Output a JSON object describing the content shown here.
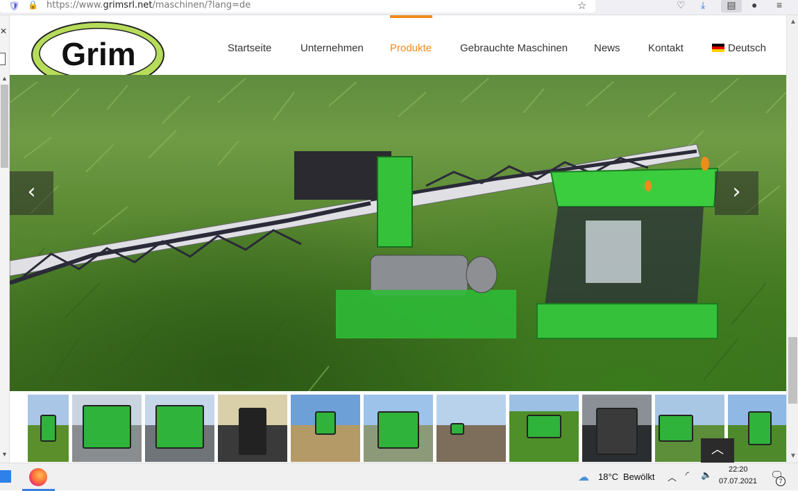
{
  "browser": {
    "url_prefix": "https://www.",
    "url_domain": "grimsrl.net",
    "url_path": "/maschinen/?lang=de"
  },
  "header": {
    "logo_text": "Grim",
    "nav": [
      {
        "label": "Startseite"
      },
      {
        "label": "Unternehmen"
      },
      {
        "label": "Produkte",
        "active": true
      },
      {
        "label": "Gebrauchte Maschinen"
      },
      {
        "label": "News"
      },
      {
        "label": "Kontakt"
      },
      {
        "label": "Deutsch"
      }
    ],
    "accent_color": "#f08a1c"
  },
  "slider": {
    "prev_icon": "chevron-left-icon",
    "next_icon": "chevron-right-icon",
    "prev_glyph": "‹",
    "next_glyph": "›"
  },
  "thumbnails": {
    "count": 11,
    "back_to_top_glyph": "︿"
  },
  "taskbar": {
    "temperature": "18°C",
    "condition": "Bewölkt",
    "time": "22:20",
    "date": "07.07.2021",
    "notification_count": "7"
  }
}
